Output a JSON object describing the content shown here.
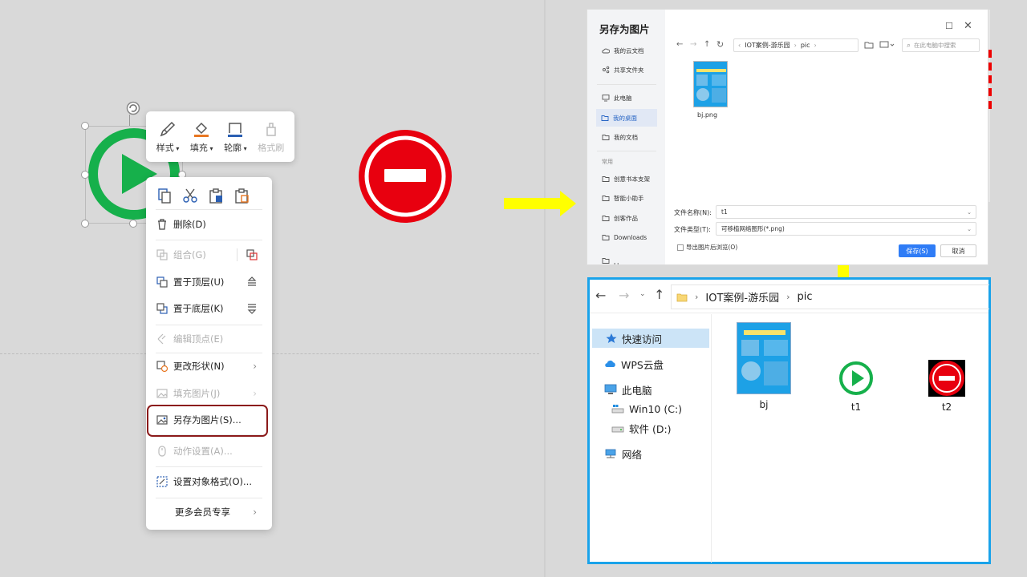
{
  "mini_toolbar": {
    "style": "样式",
    "fill": "填充",
    "outline": "轮廓",
    "format_painter": "格式刷"
  },
  "context_menu": {
    "delete": "删除(D)",
    "group": "组合(G)",
    "bring_to_front": "置于顶层(U)",
    "send_to_back": "置于底层(K)",
    "edit_points": "编辑顶点(E)",
    "change_shape": "更改形状(N)",
    "fill_picture": "填充图片(J)",
    "save_as_picture": "另存为图片(S)...",
    "animation": "动作设置(A)...",
    "format_object": "设置对象格式(O)...",
    "member_more": "更多会员专享"
  },
  "save_dialog": {
    "title": "另存为图片",
    "sidebar": {
      "cloud_docs": "我的云文档",
      "shared": "共享文件夹",
      "this_pc": "此电脑",
      "desktop": "我的桌面",
      "documents": "我的文档",
      "common_label": "常用",
      "item_1": "创意书本支架",
      "item_2": "智能小助手",
      "item_3": "创客作品",
      "downloads": "Downloads",
      "cut_off": "Ll"
    },
    "breadcrumb": [
      "IOT案例-游乐园",
      "pic"
    ],
    "search_placeholder": "在此电脑中搜索",
    "file_name": "bj.png",
    "filename_label": "文件名称(N):",
    "filename_value": "t1",
    "filetype_label": "文件类型(T):",
    "filetype_value": "可移植网络图形(*.png)",
    "preview_checkbox": "导出图片后浏览(O)",
    "save_button": "保存(S)",
    "cancel_button": "取消"
  },
  "explorer": {
    "breadcrumb": [
      "IOT案例-游乐园",
      "pic"
    ],
    "sidebar": {
      "quick_access": "快速访问",
      "wps_cloud": "WPS云盘",
      "this_pc": "此电脑",
      "drive_c": "Win10 (C:)",
      "drive_d": "软件 (D:)",
      "network": "网络"
    },
    "files": [
      "bj",
      "t1",
      "t2"
    ]
  },
  "colors": {
    "play_green": "#16b04b",
    "stop_red": "#e8000f",
    "highlight_border": "#8b1a1a",
    "arrow_yellow": "#ffff00",
    "explorer_border": "#1aa3ea",
    "save_blue": "#2f7cf6"
  }
}
